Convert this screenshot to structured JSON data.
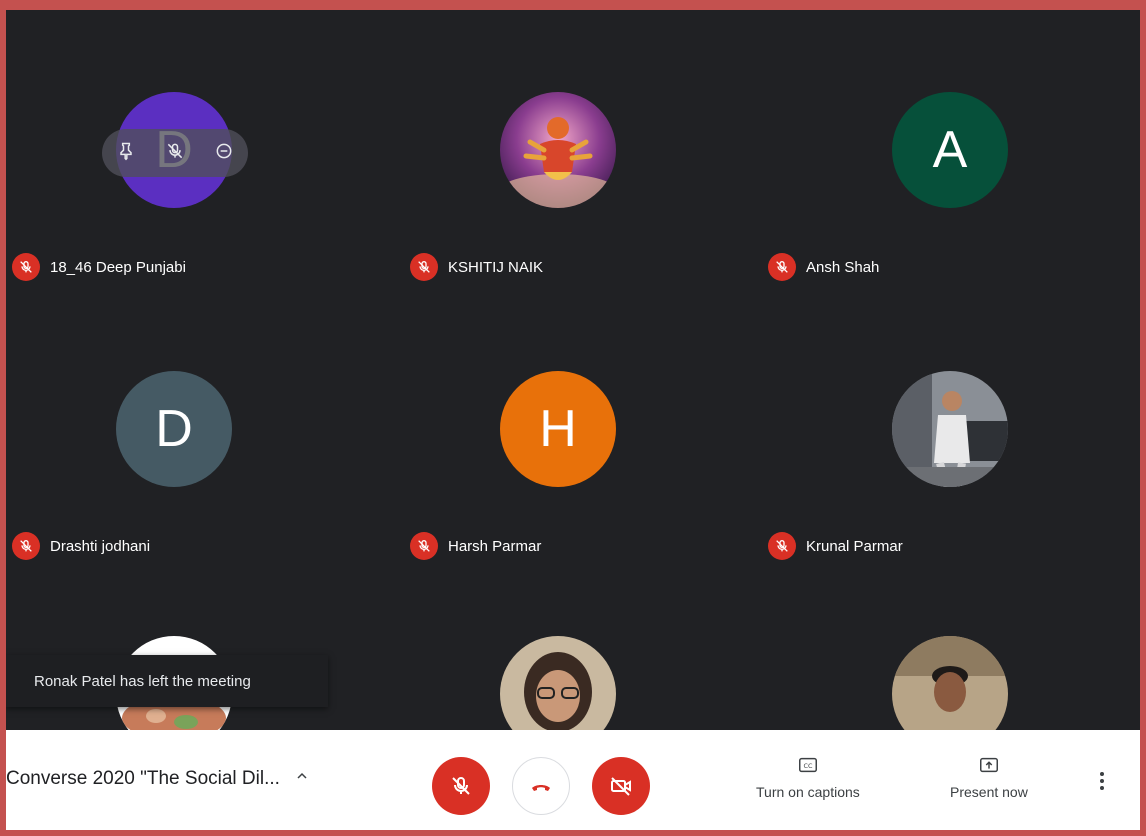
{
  "participants": [
    {
      "name": "18_46 Deep Punjabi",
      "initial": "D",
      "avatar_color": "#5b2fc1"
    },
    {
      "name": "KSHITIJ NAIK",
      "photo": "deity-icon"
    },
    {
      "name": "Ansh Shah",
      "initial": "A",
      "avatar_color": "#06503a"
    },
    {
      "name": "Drashti jodhani",
      "initial": "D",
      "avatar_color": "#455a64"
    },
    {
      "name": "Harsh Parmar",
      "initial": "H",
      "avatar_color": "#e8710a"
    },
    {
      "name": "Krunal Parmar",
      "photo": "person-photo-icon"
    },
    {
      "name": "",
      "photo": "food-photo-icon"
    },
    {
      "name": "",
      "photo": "woman-photo-icon"
    },
    {
      "name": "",
      "photo": "man-photo-icon"
    }
  ],
  "toast": {
    "message": "Ronak Patel has left the meeting"
  },
  "meeting": {
    "title": "Converse 2020 \"The Social Dil..."
  },
  "actions": {
    "captions_label": "Turn on captions",
    "present_label": "Present now"
  },
  "colors": {
    "stage": "#202124",
    "mute_red": "#d93025",
    "frame": "#c4514f"
  }
}
